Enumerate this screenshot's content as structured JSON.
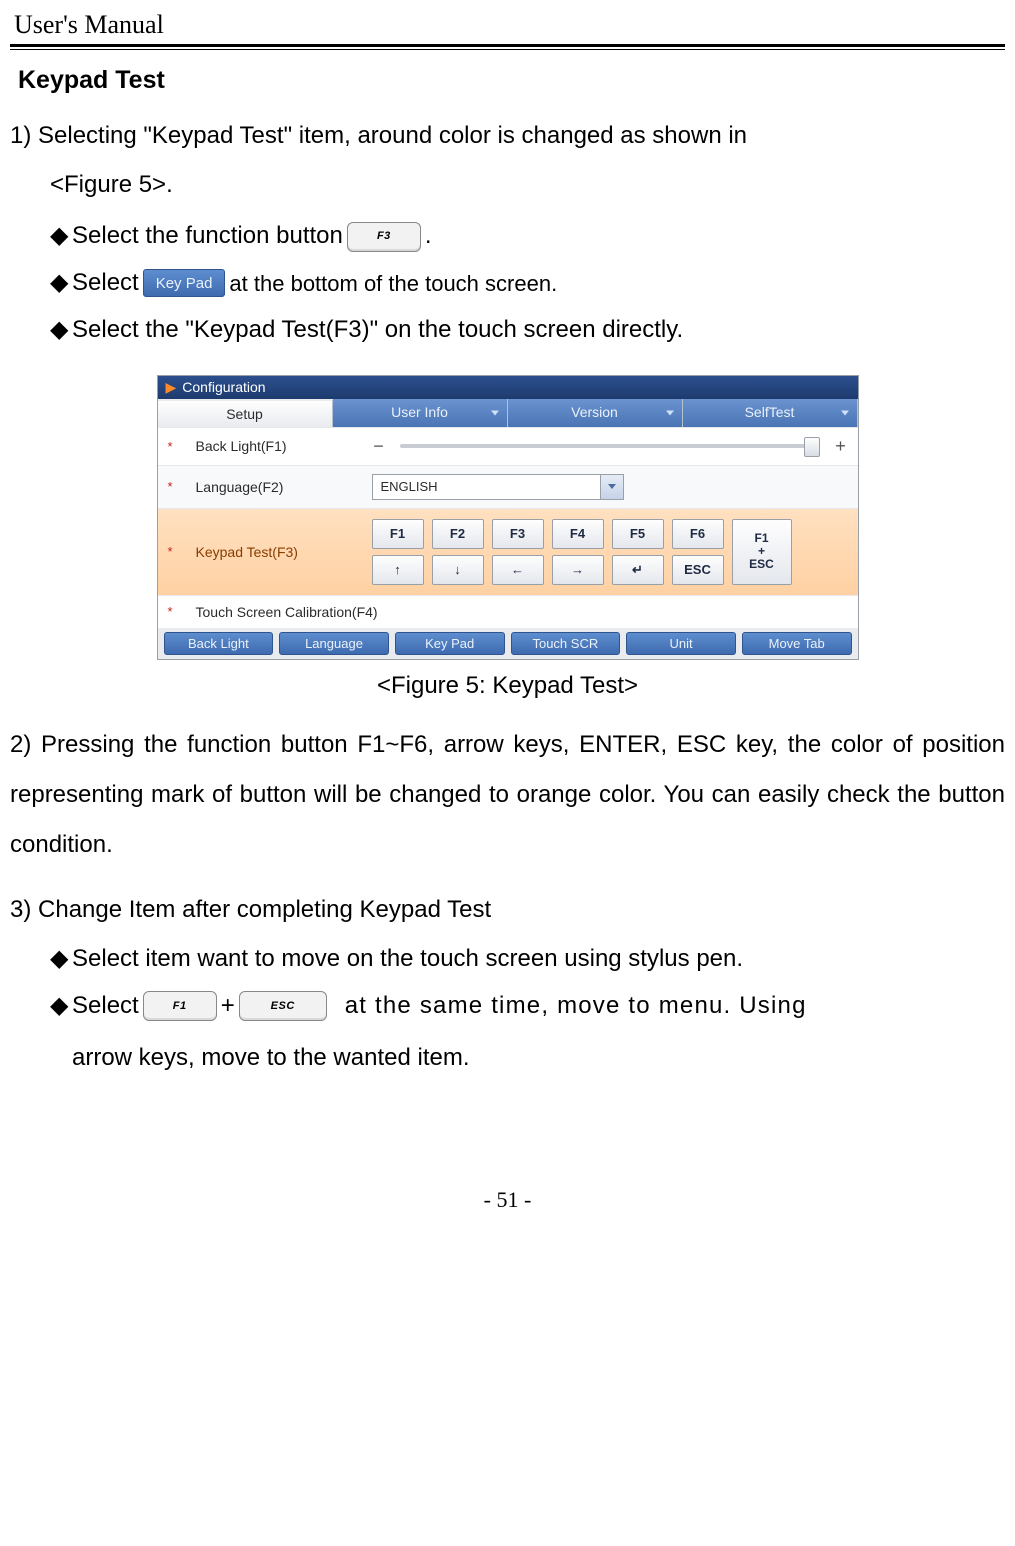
{
  "doc": {
    "header": "User's Manual",
    "page_footer": "- 51 -"
  },
  "section": {
    "title": "Keypad Test",
    "step1_a": "1) Selecting \"Keypad Test\" item, around color is changed as shown in",
    "step1_b": "<Figure 5>.",
    "b1_a": "Select the function button",
    "b1_b": ".",
    "b1_key": "F3",
    "b2_a": "Select",
    "b2_key": "Key Pad",
    "b2_b": "at the bottom of the touch screen.",
    "b3": "Select the \"Keypad Test(F3)\" on the touch screen directly.",
    "figcaption": "<Figure 5: Keypad Test>",
    "step2": "2) Pressing the function button F1~F6, arrow keys, ENTER, ESC key, the color of position representing mark of button will be changed to orange color. You can easily check the button condition.",
    "step3": "3) Change Item after completing Keypad Test",
    "s3b1": "Select item want to move on the touch screen using stylus pen.",
    "s3b2_a": "Select",
    "s3b2_plus": "+",
    "s3b2_b": "at the same time, move to menu. Using",
    "s3b2_c": "arrow keys, move to the wanted item.",
    "s3b2_k1": "F1",
    "s3b2_k2": "ESC"
  },
  "screen": {
    "title": "Configuration",
    "tabs": [
      "Setup",
      "User Info",
      "Version",
      "SelfTest"
    ],
    "rows": {
      "r1": "Back Light(F1)",
      "r2": "Language(F2)",
      "r2_value": "ENGLISH",
      "r3": "Keypad Test(F3)",
      "r4": "Touch Screen Calibration(F4)"
    },
    "keys_top": [
      "F1",
      "F2",
      "F3",
      "F4",
      "F5",
      "F6"
    ],
    "keys_bot": [
      "↑",
      "↓",
      "←",
      "→",
      "↵",
      "ESC"
    ],
    "key_span": "F1\n+\nESC",
    "bottom_buttons": [
      "Back Light",
      "Language",
      "Key Pad",
      "Touch SCR",
      "Unit",
      "Move Tab"
    ],
    "slider_minus": "−",
    "slider_plus": "+"
  },
  "bullet": "◆"
}
